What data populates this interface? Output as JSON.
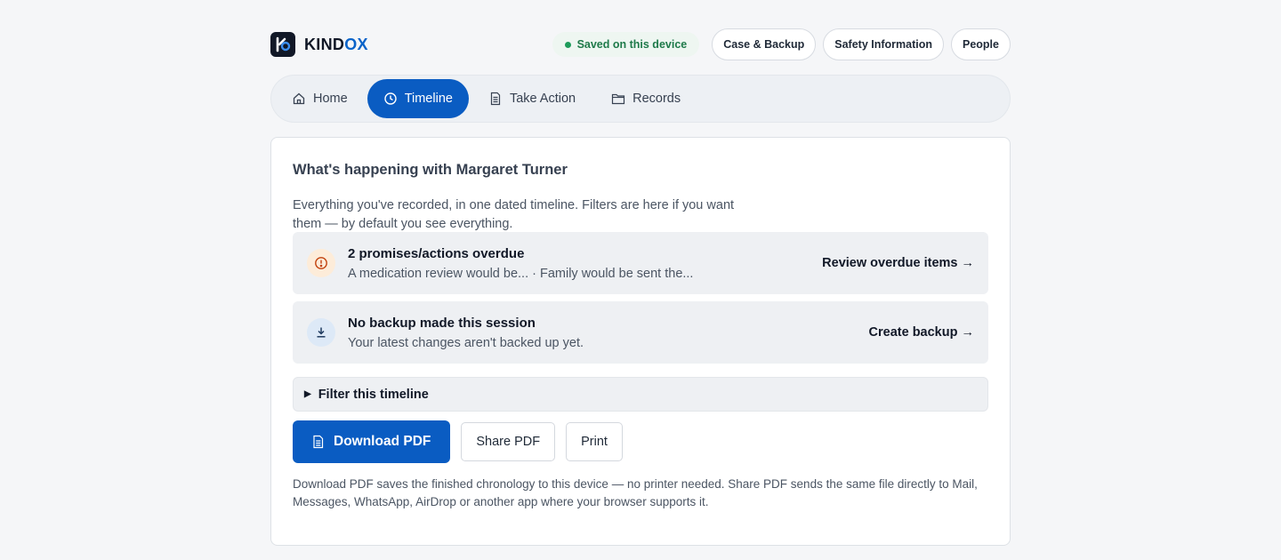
{
  "brand": {
    "name_main": "KIND",
    "name_accent": "OX",
    "logo_icon": "kindox-logo-icon"
  },
  "header": {
    "saved_status": "Saved on this device",
    "links": [
      "Case & Backup",
      "Safety Information",
      "People"
    ]
  },
  "nav": {
    "items": [
      {
        "label": "Home",
        "icon": "home-icon",
        "active": false
      },
      {
        "label": "Timeline",
        "icon": "clock-icon",
        "active": true
      },
      {
        "label": "Take Action",
        "icon": "document-icon",
        "active": false
      },
      {
        "label": "Records",
        "icon": "folder-icon",
        "active": false
      }
    ]
  },
  "main": {
    "title": "What's happening with Margaret Turner",
    "intro": "Everything you've recorded, in one dated timeline. Filters are here if you want them — by default you see everything.",
    "alerts": [
      {
        "icon": "warning-icon",
        "heading": "2 promises/actions overdue",
        "summary": "A medication review would be... · Family would be sent the...",
        "action": "Review overdue items →"
      },
      {
        "icon": "download-icon",
        "heading": "No backup made this session",
        "summary": "Your latest changes aren't backed up yet.",
        "action": "Create backup →"
      }
    ],
    "filter_label": "Filter this timeline",
    "buttons": {
      "download": "Download PDF",
      "share": "Share PDF",
      "print": "Print"
    },
    "note": "Download PDF saves the finished chronology to this device — no printer needed. Share PDF sends the same file directly to Mail, Messages, WhatsApp, AirDrop or another app where your browser supports it."
  },
  "colors": {
    "accent": "#0a5cc2",
    "saved_green": "#1e9b5a",
    "warning": "#c2410c"
  }
}
